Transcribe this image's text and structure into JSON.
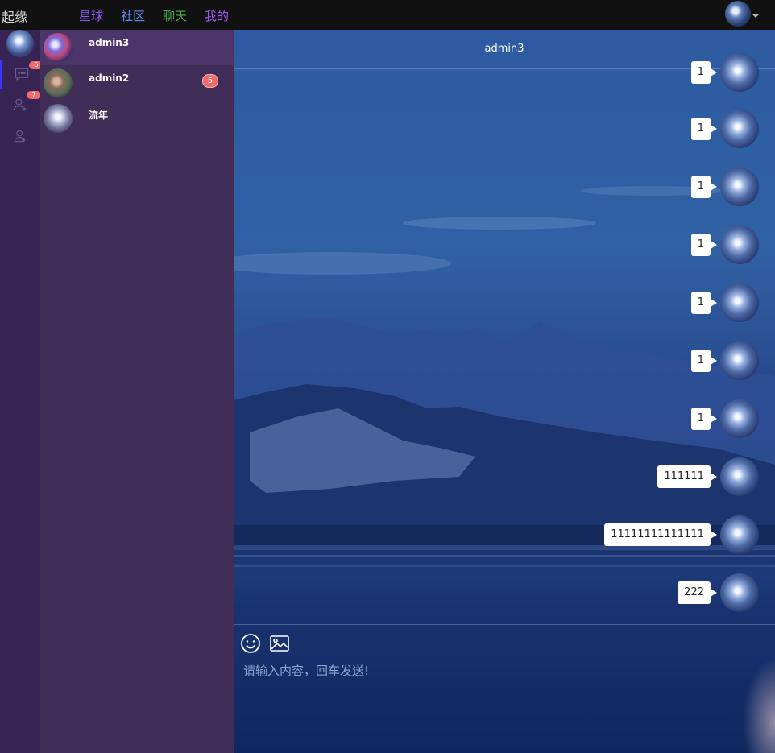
{
  "app": {
    "brand": "起缘"
  },
  "nav": [
    {
      "label": "星球",
      "color": "#8a5cf6"
    },
    {
      "label": "社区",
      "color": "#5b8ef0"
    },
    {
      "label": "聊天",
      "color": "#4caf50"
    },
    {
      "label": "我的",
      "color": "#a259f7"
    }
  ],
  "rail": {
    "items": [
      {
        "icon": "chat-bubble-icon",
        "badge": "5",
        "active": true
      },
      {
        "icon": "add-friend-icon",
        "badge": "7",
        "active": false
      },
      {
        "icon": "contacts-icon",
        "badge": "",
        "active": false
      }
    ]
  },
  "conversations": [
    {
      "name": "admin3",
      "badge": "",
      "active": true
    },
    {
      "name": "admin2",
      "badge": "5",
      "active": false
    },
    {
      "name": "流年",
      "badge": "",
      "active": false
    }
  ],
  "chat": {
    "title": "admin3",
    "messages": [
      "1",
      "1",
      "1",
      "1",
      "1",
      "1",
      "1",
      "111111",
      "11111111111111",
      "222"
    ],
    "input_placeholder": "请输入内容，回车发送!",
    "toolbar": [
      "emoji-icon",
      "image-icon"
    ]
  }
}
